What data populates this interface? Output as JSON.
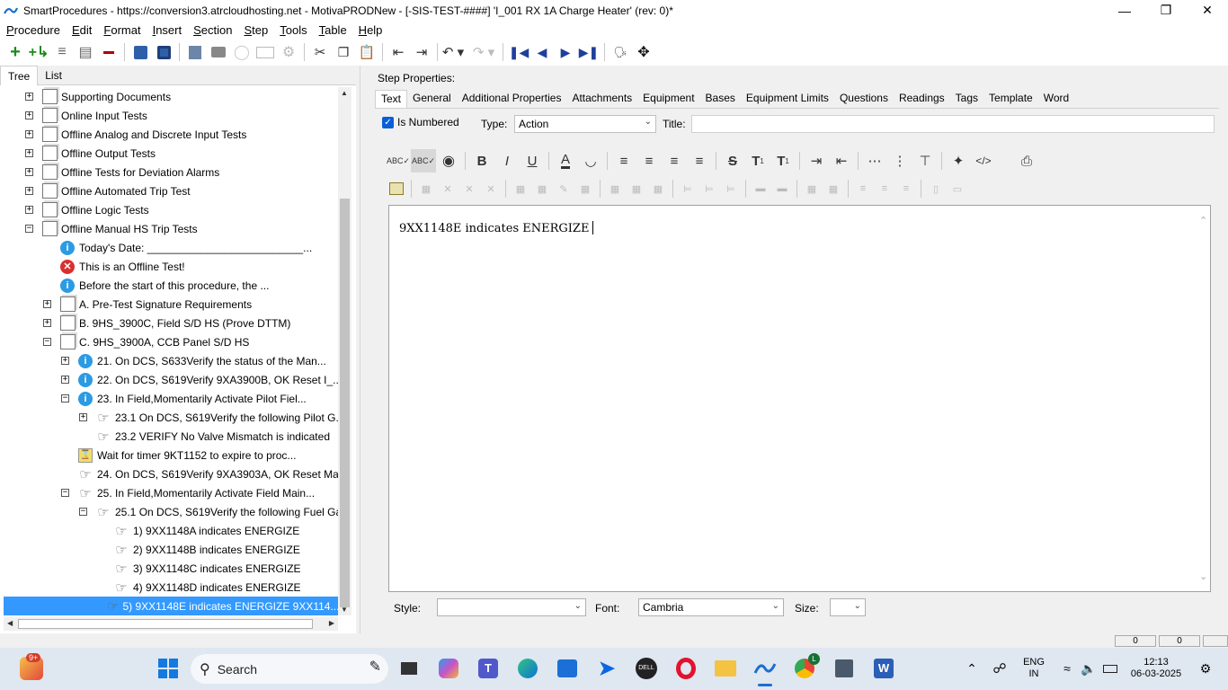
{
  "window": {
    "title": "SmartProcedures - https://conversion3.atrcloudhosting.net - MotivaPRODNew - [-SIS-TEST-####] 'I_001 RX 1A Charge Heater' (rev: 0)*"
  },
  "menu": [
    "Procedure",
    "Edit",
    "Format",
    "Insert",
    "Section",
    "Step",
    "Tools",
    "Table",
    "Help"
  ],
  "left_tabs": [
    "Tree",
    "List"
  ],
  "tree": [
    {
      "label": "Supporting Documents",
      "indent": 0,
      "exp": "+",
      "icon": "doc"
    },
    {
      "label": "Online Input Tests",
      "indent": 0,
      "exp": "+",
      "icon": "doc"
    },
    {
      "label": "Offline Analog and Discrete Input Tests",
      "indent": 0,
      "exp": "+",
      "icon": "doc"
    },
    {
      "label": "Offline Output Tests",
      "indent": 0,
      "exp": "+",
      "icon": "doc"
    },
    {
      "label": "Offline Tests for Deviation Alarms",
      "indent": 0,
      "exp": "+",
      "icon": "doc"
    },
    {
      "label": "Offline Automated Trip Test",
      "indent": 0,
      "exp": "+",
      "icon": "doc"
    },
    {
      "label": "Offline Logic Tests",
      "indent": 0,
      "exp": "+",
      "icon": "doc"
    },
    {
      "label": "Offline Manual HS Trip Tests",
      "indent": 0,
      "exp": "-",
      "icon": "doc"
    },
    {
      "label": "Today's Date: __________________________...",
      "indent": 1,
      "exp": "",
      "icon": "info"
    },
    {
      "label": "This is an Offline Test!",
      "indent": 1,
      "exp": "",
      "icon": "error"
    },
    {
      "label": "Before the start of this procedure, the ...",
      "indent": 1,
      "exp": "",
      "icon": "info"
    },
    {
      "label": "A. Pre-Test Signature Requirements",
      "indent": 1,
      "exp": "+",
      "icon": "doc"
    },
    {
      "label": "B. 9HS_3900C, Field S/D HS (Prove DTTM)",
      "indent": 1,
      "exp": "+",
      "icon": "doc"
    },
    {
      "label": "C. 9HS_3900A, CCB Panel S/D HS",
      "indent": 1,
      "exp": "-",
      "icon": "doc"
    },
    {
      "label": "21. On DCS, S633Verify the status of the Man...",
      "indent": 2,
      "exp": "+",
      "icon": "info"
    },
    {
      "label": "22. On DCS, S619Verify 9XA3900B, OK Reset I_...",
      "indent": 2,
      "exp": "+",
      "icon": "info"
    },
    {
      "label": "23. In Field,Momentarily Activate Pilot Fiel...",
      "indent": 2,
      "exp": "-",
      "icon": "info"
    },
    {
      "label": "23.1 On DCS, S619Verify the following Pilot G...",
      "indent": 3,
      "exp": "+",
      "icon": "hand"
    },
    {
      "label": "23.2 VERIFY No Valve Mismatch is indicated",
      "indent": 3,
      "exp": "",
      "icon": "hand"
    },
    {
      "label": "Wait for timer 9KT1152 to expire to proc...",
      "indent": 2,
      "exp": "",
      "icon": "timer"
    },
    {
      "label": "24. On DCS, S619Verify 9XA3903A, OK Reset Ma...",
      "indent": 2,
      "exp": "",
      "icon": "hand"
    },
    {
      "label": "25. In Field,Momentarily Activate Field Main...",
      "indent": 2,
      "exp": "-",
      "icon": "hand"
    },
    {
      "label": "25.1 On DCS, S619Verify the following Fuel Ga...",
      "indent": 3,
      "exp": "-",
      "icon": "hand"
    },
    {
      "label": "1) 9XX1148A indicates ENERGIZE",
      "indent": 4,
      "exp": "",
      "icon": "hand"
    },
    {
      "label": "2) 9XX1148B indicates ENERGIZE",
      "indent": 4,
      "exp": "",
      "icon": "hand"
    },
    {
      "label": "3) 9XX1148C indicates ENERGIZE",
      "indent": 4,
      "exp": "",
      "icon": "hand"
    },
    {
      "label": "4) 9XX1148D indicates ENERGIZE",
      "indent": 4,
      "exp": "",
      "icon": "hand"
    },
    {
      "label": "5) 9XX1148E indicates ENERGIZE 9XX114...",
      "indent": 4,
      "exp": "",
      "icon": "hand",
      "selected": true
    }
  ],
  "step_properties": {
    "header": "Step Properties:",
    "tabs": [
      "Text",
      "General",
      "Additional Properties",
      "Attachments",
      "Equipment",
      "Bases",
      "Equipment Limits",
      "Questions",
      "Readings",
      "Tags",
      "Template",
      "Word"
    ],
    "is_numbered_label": "Is Numbered",
    "is_numbered": true,
    "type_label": "Type:",
    "type_value": "Action",
    "title_label": "Title:",
    "title_value": "",
    "editor_text": "9XX1148E indicates ENERGIZE",
    "style_label": "Style:",
    "style_value": "",
    "font_label": "Font:",
    "font_value": "Cambria",
    "size_label": "Size:",
    "size_value": ""
  },
  "status": {
    "cell1": "0",
    "cell2": "0"
  },
  "taskbar": {
    "search_placeholder": "Search",
    "notification_badge": "9+",
    "chrome_badge": "L",
    "lang_line1": "ENG",
    "lang_line2": "IN",
    "time": "12:13",
    "date": "06-03-2025"
  }
}
